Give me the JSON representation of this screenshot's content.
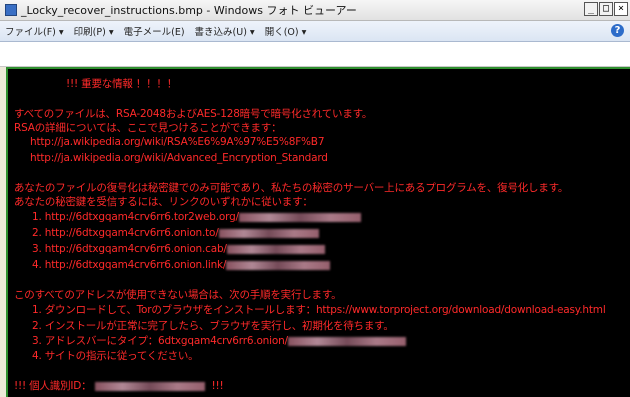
{
  "window": {
    "title": "_Locky_recover_instructions.bmp - Windows フォト ビューアー",
    "min": "_",
    "max": "□",
    "close": "×"
  },
  "menu": {
    "items": [
      "ファイル(F) ▾",
      "印刷(P) ▾",
      "電子メール(E)",
      "書き込み(U) ▾",
      "開く(O) ▾"
    ],
    "help": "?"
  },
  "note": {
    "heading": "!!! 重要な情報 ！！！！",
    "p1": "すべてのファイルは、RSA-2048およびAES-128暗号で暗号化されています。",
    "p2": "RSAの詳細については、ここで見つけることができます：",
    "links": [
      "http://ja.wikipedia.org/wiki/RSA%E6%9A%97%E5%8F%B7",
      "http://ja.wikipedia.org/wiki/Advanced_Encryption_Standard"
    ],
    "p3": "あなたのファイルの復号化は秘密鍵でのみ可能であり、私たちの秘密のサーバー上にあるプログラムを、復号化します。",
    "p4": "あなたの秘密鍵を受信するには、リンクのいずれかに従います：",
    "servers": [
      "1. http://6dtxgqam4crv6rr6.tor2web.org/",
      "2. http://6dtxgqam4crv6rr6.onion.to/",
      "3. http://6dtxgqam4crv6rr6.onion.cab/",
      "4. http://6dtxgqam4crv6rr6.onion.link/"
    ],
    "p5": "このすべてのアドレスが使用できない場合は、次の手順を実行します。",
    "steps": [
      "1. ダウンロードして、Torのブラウザをインストールします：https://www.torproject.org/download/download-easy.html",
      "2. インストールが正常に完了したら、ブラウザを実行し、初期化を待ちます。",
      "3. アドレスバーにタイプ：6dtxgqam4crv6rr6.onion/",
      "4. サイトの指示に従ってください。"
    ],
    "id_label": "!!! 個人識別ID：",
    "id_suffix": "!!!"
  },
  "colors": {
    "text": "#ff2a2a",
    "background": "#000000",
    "border": "#2f8f2f"
  }
}
